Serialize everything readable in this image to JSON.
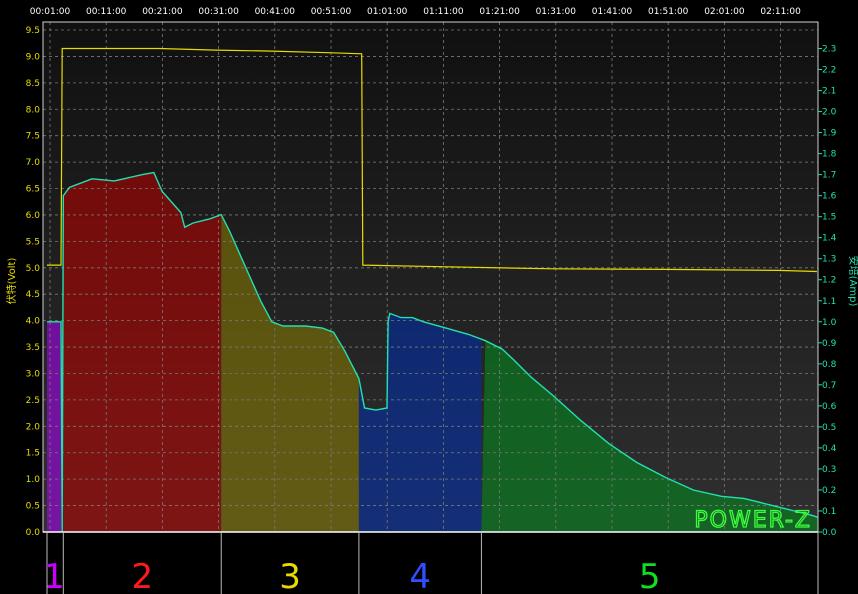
{
  "chart_data": {
    "type": "line",
    "title": "",
    "xlabel": "",
    "x_tick_labels": [
      "00:01:00",
      "00:11:00",
      "00:21:00",
      "00:31:00",
      "00:41:00",
      "00:51:00",
      "01:01:00",
      "01:11:00",
      "01:21:00",
      "01:31:00",
      "01:41:00",
      "01:51:00",
      "02:01:00",
      "02:11:00"
    ],
    "x_tick_minutes": [
      1,
      11,
      21,
      31,
      41,
      51,
      61,
      71,
      81,
      91,
      101,
      111,
      121,
      131
    ],
    "xlim_minutes": [
      0,
      137.5
    ],
    "y_left": {
      "label": "伏特(Volt)",
      "range": [
        0,
        9.5
      ],
      "ticks": [
        0.0,
        0.5,
        1.0,
        1.5,
        2.0,
        2.5,
        3.0,
        3.5,
        4.0,
        4.5,
        5.0,
        5.5,
        6.0,
        6.5,
        7.0,
        7.5,
        8.0,
        8.5,
        9.0,
        9.5
      ],
      "color": "#e6dc00"
    },
    "y_right": {
      "label": "安培(Amp)",
      "range": [
        0,
        2.35
      ],
      "ticks": [
        0.0,
        0.1,
        0.2,
        0.3,
        0.4,
        0.5,
        0.6,
        0.7,
        0.8,
        0.9,
        1.0,
        1.1,
        1.2,
        1.3,
        1.4,
        1.5,
        1.6,
        1.7,
        1.8,
        1.9,
        2.0,
        2.1,
        2.2,
        2.3
      ],
      "color": "#22e0b0"
    },
    "grid": true,
    "series": [
      {
        "name": "",
        "axis": "left",
        "color": "#e6dc00",
        "points": [
          [
            0,
            5.05
          ],
          [
            2.5,
            5.05
          ],
          [
            2.7,
            9.15
          ],
          [
            10,
            9.15
          ],
          [
            20,
            9.15
          ],
          [
            30,
            9.12
          ],
          [
            40,
            9.1
          ],
          [
            50,
            9.07
          ],
          [
            56,
            9.05
          ],
          [
            56.2,
            5.05
          ],
          [
            70,
            5.02
          ],
          [
            90,
            4.98
          ],
          [
            110,
            4.97
          ],
          [
            130,
            4.95
          ],
          [
            137,
            4.93
          ]
        ]
      },
      {
        "name": "",
        "axis": "right",
        "color": "#22e0b0",
        "points": [
          [
            0,
            1.0
          ],
          [
            2.5,
            1.0
          ],
          [
            2.7,
            0.0
          ],
          [
            2.9,
            1.6
          ],
          [
            4,
            1.64
          ],
          [
            8,
            1.68
          ],
          [
            12,
            1.67
          ],
          [
            17,
            1.7
          ],
          [
            19,
            1.71
          ],
          [
            20.5,
            1.62
          ],
          [
            23.8,
            1.52
          ],
          [
            24.5,
            1.45
          ],
          [
            26,
            1.47
          ],
          [
            29,
            1.49
          ],
          [
            31,
            1.51
          ],
          [
            32.5,
            1.43
          ],
          [
            34,
            1.34
          ],
          [
            36,
            1.22
          ],
          [
            38,
            1.1
          ],
          [
            40,
            1.0
          ],
          [
            42,
            0.98
          ],
          [
            46,
            0.98
          ],
          [
            49,
            0.97
          ],
          [
            51,
            0.95
          ],
          [
            53,
            0.86
          ],
          [
            55.5,
            0.73
          ],
          [
            56.5,
            0.59
          ],
          [
            58.5,
            0.58
          ],
          [
            60.5,
            0.59
          ],
          [
            60.7,
            1.0
          ],
          [
            61,
            1.04
          ],
          [
            63,
            1.02
          ],
          [
            65,
            1.02
          ],
          [
            67,
            1.0
          ],
          [
            71,
            0.97
          ],
          [
            75,
            0.94
          ],
          [
            78,
            0.91
          ],
          [
            81,
            0.87
          ],
          [
            83,
            0.82
          ],
          [
            86,
            0.74
          ],
          [
            90,
            0.65
          ],
          [
            95,
            0.53
          ],
          [
            100,
            0.42
          ],
          [
            105,
            0.33
          ],
          [
            110,
            0.26
          ],
          [
            115,
            0.2
          ],
          [
            120,
            0.17
          ],
          [
            124,
            0.16
          ],
          [
            127,
            0.14
          ],
          [
            130,
            0.12
          ],
          [
            133,
            0.1
          ],
          [
            136,
            0.08
          ],
          [
            137.5,
            0.07
          ]
        ]
      }
    ],
    "phases": [
      {
        "label": "1",
        "start": 0,
        "end": 2.5,
        "fill": "#b000ff",
        "text_color": "#cc00ff"
      },
      {
        "label": "2",
        "start": 2.9,
        "end": 31,
        "fill": "#c00000",
        "text_color": "#ff1a1a"
      },
      {
        "label": "3",
        "start": 31,
        "end": 55.5,
        "fill": "#8c8000",
        "text_color": "#e6dc00"
      },
      {
        "label": "4",
        "start": 55.5,
        "end": 77.3,
        "fill": "#0030b0",
        "text_color": "#3050ff"
      },
      {
        "label": "5",
        "start": 77.3,
        "end": 137.5,
        "fill": "#00901e",
        "text_color": "#10e020"
      }
    ],
    "watermark": "POWER-Z",
    "colors": {
      "background": "#000000",
      "grid": "#7a7a7a",
      "axis": "#cfcfcf",
      "tick_text": "#ffffff"
    }
  }
}
